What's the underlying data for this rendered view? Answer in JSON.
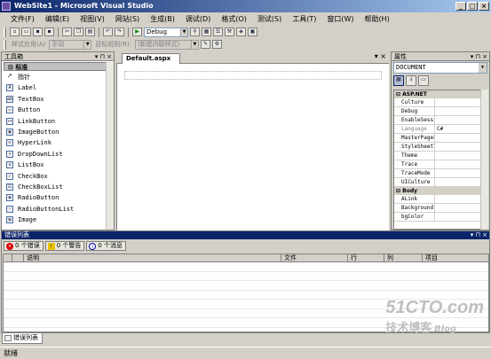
{
  "window": {
    "title": "WebSite1 - Microsoft Visual Studio",
    "min": "_",
    "max": "□",
    "close": "×"
  },
  "menu": [
    "文件(F)",
    "编辑(E)",
    "视图(V)",
    "网站(S)",
    "生成(B)",
    "调试(D)",
    "格式(O)",
    "测试(S)",
    "工具(T)",
    "窗口(W)",
    "帮助(H)"
  ],
  "toolbar": {
    "config_value": "Debug",
    "style_label": "样式应用(A)",
    "style_value": "手动",
    "target_label": "目标规则(R):",
    "target_value": "(新建内联样式)"
  },
  "toolbox": {
    "title": "工具箱",
    "pin": "▾ ⊓ ×",
    "group": "标准",
    "items": [
      "指针",
      "Label",
      "TextBox",
      "Button",
      "LinkButton",
      "ImageButton",
      "HyperLink",
      "DropDownList",
      "ListBox",
      "CheckBox",
      "CheckBoxList",
      "RadioButton",
      "RadioButtonList",
      "Image"
    ]
  },
  "editor": {
    "tab": "Default.aspx",
    "ctrl_dropdown": "▾",
    "ctrl_close": "×"
  },
  "properties": {
    "title": "属性",
    "pin": "▾ ⊓ ×",
    "object": "DOCUMENT",
    "category1": "ASP.NET",
    "rows1": [
      {
        "name": "Culture",
        "value": ""
      },
      {
        "name": "Debug",
        "value": ""
      },
      {
        "name": "EnableSessi",
        "value": ""
      },
      {
        "name": "Language",
        "value": "C#"
      },
      {
        "name": "MasterPageF",
        "value": ""
      },
      {
        "name": "StyleSheetT",
        "value": ""
      },
      {
        "name": "Theme",
        "value": ""
      },
      {
        "name": "Trace",
        "value": ""
      },
      {
        "name": "TraceMode",
        "value": ""
      },
      {
        "name": "UICulture",
        "value": ""
      }
    ],
    "category2": "Body",
    "rows2": [
      {
        "name": "ALink",
        "value": ""
      },
      {
        "name": "Background",
        "value": ""
      },
      {
        "name": "bgColor",
        "value": ""
      }
    ]
  },
  "errorlist": {
    "title": "错误列表",
    "pin": "▾ ⊓ ×",
    "errors": "0 个错误",
    "warnings": "0 个警告",
    "messages": "0 个消息",
    "columns": [
      "",
      "说明",
      "文件",
      "行",
      "列",
      "项目"
    ]
  },
  "bottomtab": "错误列表",
  "status": "就绪",
  "watermark": {
    "site": "51CTO.com",
    "cn": "技术博客",
    "blog": "Blog"
  }
}
